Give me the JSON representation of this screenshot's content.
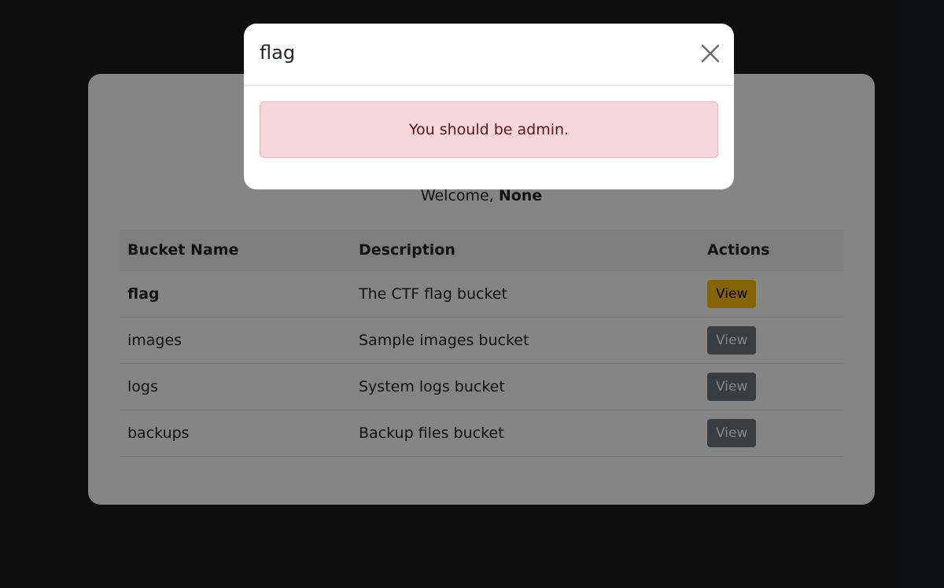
{
  "page": {
    "welcome_prefix": "Welcome, ",
    "welcome_user": "None"
  },
  "table": {
    "headers": [
      "Bucket Name",
      "Description",
      "Actions"
    ],
    "rows": [
      {
        "name": "flag",
        "description": "The CTF flag bucket",
        "action": "View"
      },
      {
        "name": "images",
        "description": "Sample images bucket",
        "action": "View"
      },
      {
        "name": "logs",
        "description": "System logs bucket",
        "action": "View"
      },
      {
        "name": "backups",
        "description": "Backup files bucket",
        "action": "View"
      }
    ]
  },
  "modal": {
    "title": "flag",
    "message": "You should be admin.",
    "close_icon": "close-icon"
  },
  "colors": {
    "warning": "#ffc107",
    "secondary": "#6c757d",
    "alert_bg": "#f8d7da",
    "alert_text": "#58151c"
  }
}
